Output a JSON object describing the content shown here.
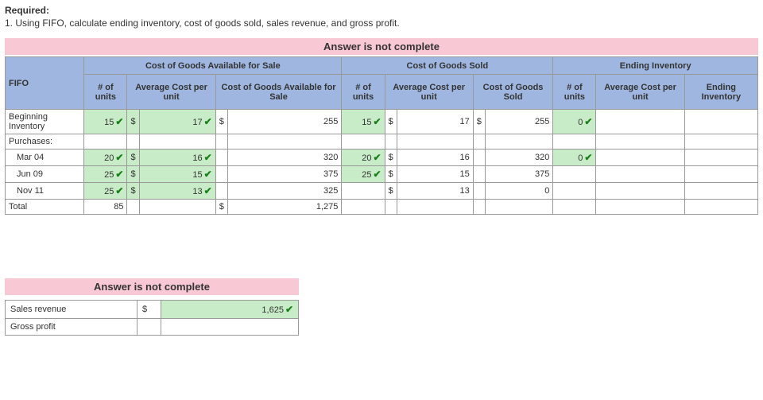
{
  "required_label": "Required:",
  "required_text": "1. Using FIFO, calculate ending inventory, cost of goods sold, sales revenue, and gross profit.",
  "banner_main": "Answer is not complete",
  "headers": {
    "fifo": "FIFO",
    "cogas": "Cost of Goods Available for Sale",
    "cogs": "Cost of Goods Sold",
    "ei": "Ending Inventory",
    "units": "# of units",
    "avg": "Average Cost per unit",
    "cogas_col": "Cost of Goods Available for Sale",
    "cogs_col": "Cost of Goods Sold",
    "ei_col": "Ending Inventory"
  },
  "rows": {
    "begin": {
      "label": "Beginning Inventory",
      "a_units": "15",
      "a_units_ok": true,
      "a_avg": "17",
      "a_avg_ok": true,
      "a_avg_dollar": "$",
      "a_cost": "255",
      "a_cost_dollar": "$",
      "s_units": "15",
      "s_units_ok": true,
      "s_avg": "17",
      "s_avg_dollar": "$",
      "s_cost": "255",
      "s_cost_dollar": "$",
      "e_units": "0",
      "e_units_ok": true
    },
    "purchases_label": "Purchases:",
    "mar04": {
      "label": "Mar 04",
      "a_units": "20",
      "a_units_ok": true,
      "a_avg": "16",
      "a_avg_ok": true,
      "a_avg_dollar": "$",
      "a_cost": "320",
      "s_units": "20",
      "s_units_ok": true,
      "s_avg": "16",
      "s_avg_dollar": "$",
      "s_cost": "320",
      "e_units": "0",
      "e_units_ok": true
    },
    "jun09": {
      "label": "Jun 09",
      "a_units": "25",
      "a_units_ok": true,
      "a_avg": "15",
      "a_avg_ok": true,
      "a_avg_dollar": "$",
      "a_cost": "375",
      "s_units": "25",
      "s_units_ok": true,
      "s_avg": "15",
      "s_avg_dollar": "$",
      "s_cost": "375"
    },
    "nov11": {
      "label": "Nov 11",
      "a_units": "25",
      "a_units_ok": true,
      "a_avg": "13",
      "a_avg_ok": true,
      "a_avg_dollar": "$",
      "a_cost": "325",
      "s_avg": "13",
      "s_avg_dollar": "$",
      "s_cost": "0"
    },
    "total": {
      "label": "Total",
      "a_units": "85",
      "a_cost": "1,275",
      "a_cost_dollar": "$"
    }
  },
  "banner_summary": "Answer is not complete",
  "summary": {
    "sales_label": "Sales revenue",
    "sales_dollar": "$",
    "sales_value": "1,625",
    "sales_ok": true,
    "gross_label": "Gross profit"
  }
}
